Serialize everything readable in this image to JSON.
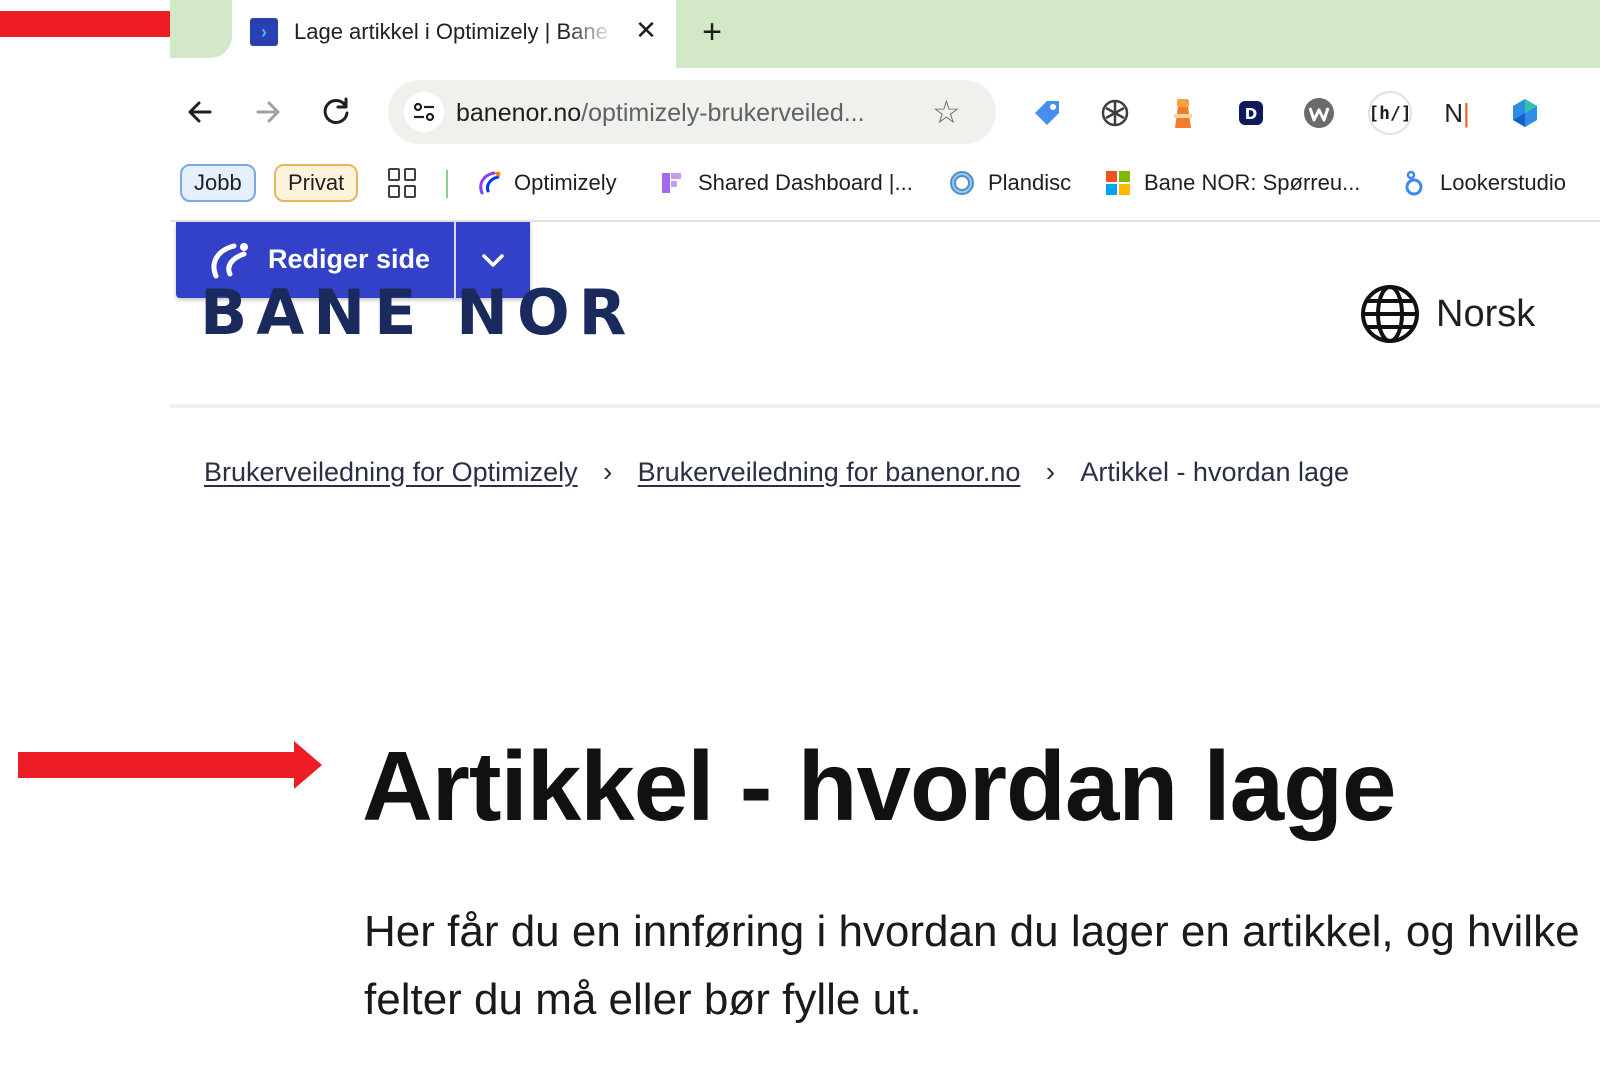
{
  "browser": {
    "tab": {
      "title": "Lage artikkel i Optimizely | Bane NOR",
      "close_label": "✕"
    },
    "new_tab_label": "+",
    "address_bar": {
      "url_host": "banenor.no",
      "url_path": "/optimizely-brukerveiled..."
    },
    "extensions": [
      "tag-extension-icon",
      "openai-extension-icon",
      "lighthouse-extension-icon",
      "dashlane-extension-icon",
      "wappalyzer-extension-icon",
      "hv-extension-icon",
      "notion-extension-icon",
      "copilot-extension-icon"
    ],
    "bookmarks": {
      "chip_jobb": "Jobb",
      "chip_privat": "Privat",
      "items": [
        {
          "label": "Optimizely",
          "icon": "optimizely-icon"
        },
        {
          "label": "Shared Dashboard |...",
          "icon": "dashboard-icon"
        },
        {
          "label": "Plandisc",
          "icon": "plandisc-icon"
        },
        {
          "label": "Bane NOR: Spørreu...",
          "icon": "microsoft-forms-icon"
        },
        {
          "label": "Lookerstudio",
          "icon": "lookerstudio-icon"
        }
      ]
    }
  },
  "edit_toolbar": {
    "edit_label": "Rediger side"
  },
  "site_header": {
    "logo_text": "BANE NOR",
    "language_label": "Norsk"
  },
  "breadcrumb": {
    "items": [
      {
        "label": "Brukerveiledning for Optimizely"
      },
      {
        "label": "Brukerveiledning for banenor.no"
      }
    ],
    "current": "Artikkel - hvordan lage",
    "separator": "›"
  },
  "article": {
    "title": "Artikkel - hvordan lage",
    "intro": "Her får du en innføring i hvordan du lager en artikkel, og hvilke felter du må eller bør fylle ut."
  },
  "colors": {
    "tabstrip": "#d2e8c6",
    "edit_button": "#3241c8",
    "logo": "#1b2a5c",
    "annotation_arrow": "#ee1c24"
  }
}
